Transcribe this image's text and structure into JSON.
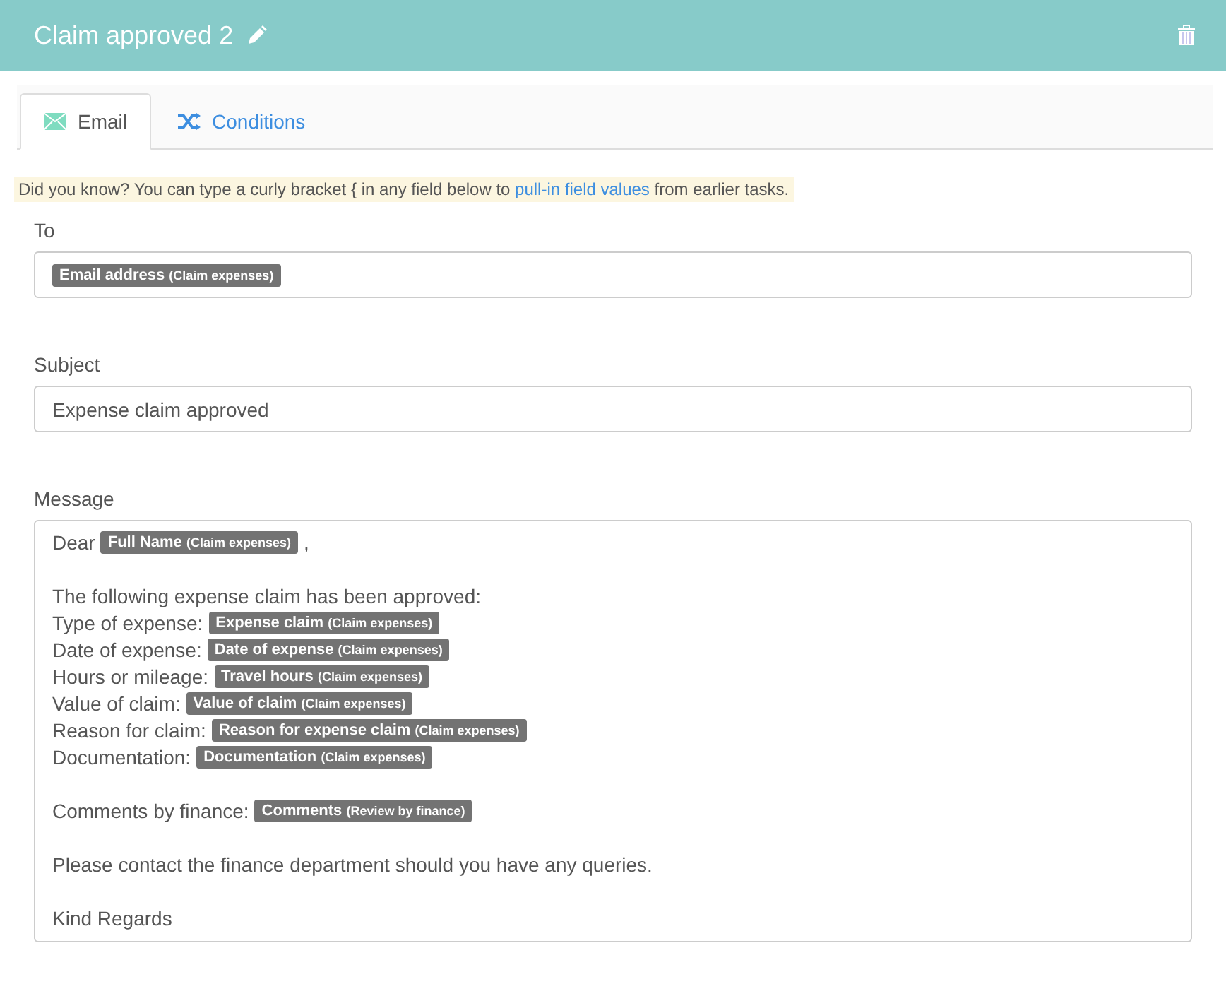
{
  "header": {
    "title": "Claim approved 2"
  },
  "tabs": [
    {
      "label": "Email",
      "selected": true
    },
    {
      "label": "Conditions",
      "selected": false
    }
  ],
  "hint": {
    "before": "Did you know? You can type a curly bracket { in any field below to",
    "link": "pull-in field values",
    "after": "from earlier tasks."
  },
  "to": {
    "label": "To",
    "tokens": [
      {
        "field": "Email address",
        "source": "(Claim expenses)"
      }
    ]
  },
  "subject": {
    "label": "Subject",
    "value": "Expense claim approved"
  },
  "message": {
    "label": "Message",
    "lines": [
      {
        "kind": "line",
        "text": "Dear",
        "token": {
          "field": "Full Name",
          "source": "(Claim expenses)"
        },
        "suffix": ","
      },
      {
        "kind": "blank"
      },
      {
        "kind": "line",
        "text": "The following expense claim has been approved:"
      },
      {
        "kind": "line",
        "text": "Type of expense:",
        "token": {
          "field": "Expense claim",
          "source": "(Claim expenses)"
        }
      },
      {
        "kind": "line",
        "text": "Date of expense:",
        "token": {
          "field": "Date of expense",
          "source": "(Claim expenses)"
        }
      },
      {
        "kind": "line",
        "text": "Hours or mileage:",
        "token": {
          "field": "Travel hours",
          "source": "(Claim expenses)"
        }
      },
      {
        "kind": "line",
        "text": "Value of claim:",
        "token": {
          "field": "Value of claim",
          "source": "(Claim expenses)"
        }
      },
      {
        "kind": "line",
        "text": "Reason for claim:",
        "token": {
          "field": "Reason for expense claim",
          "source": "(Claim expenses)"
        }
      },
      {
        "kind": "line",
        "text": "Documentation:",
        "token": {
          "field": "Documentation",
          "source": "(Claim expenses)"
        }
      },
      {
        "kind": "blank"
      },
      {
        "kind": "line",
        "text": "Comments by finance:",
        "token": {
          "field": "Comments",
          "source": "(Review by finance)"
        }
      },
      {
        "kind": "blank"
      },
      {
        "kind": "line",
        "text": "Please contact the finance department should you have any queries."
      },
      {
        "kind": "blank"
      },
      {
        "kind": "line",
        "text": "Kind Regards"
      }
    ]
  }
}
